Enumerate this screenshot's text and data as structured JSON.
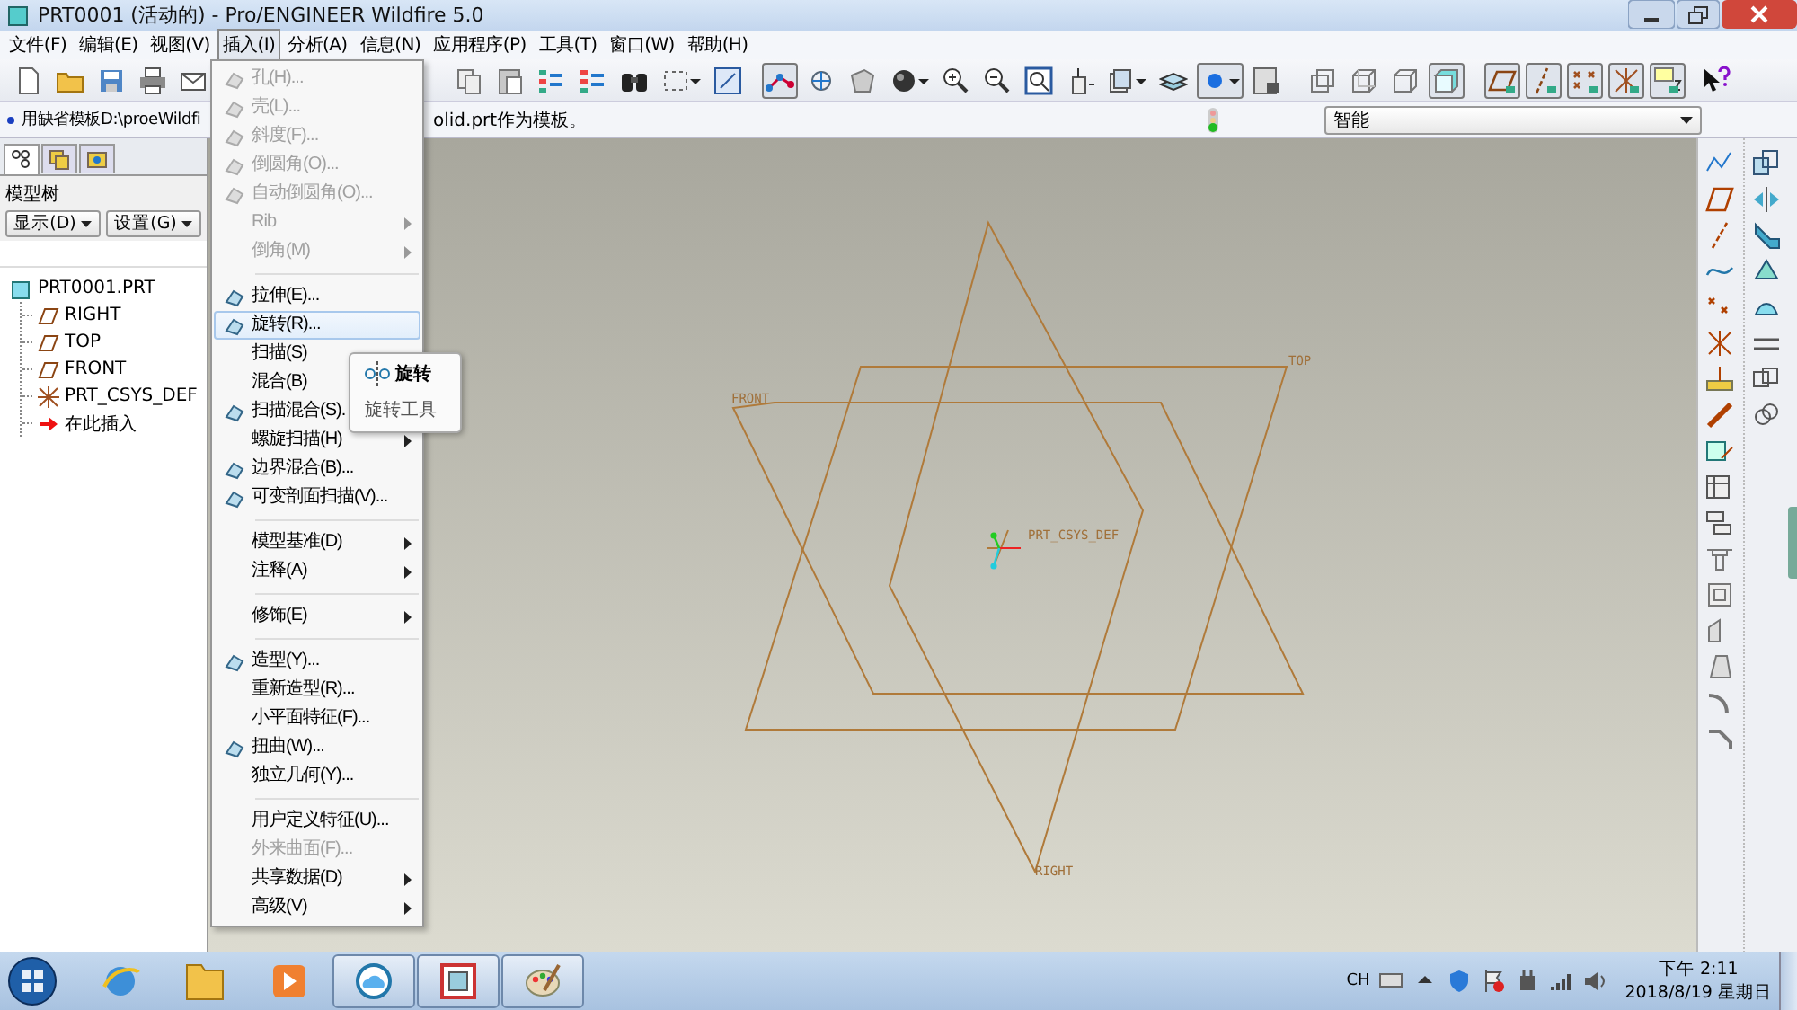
{
  "window": {
    "title": "PRT0001 (活动的) - Pro/ENGINEER Wildfire 5.0"
  },
  "menubar": [
    {
      "label": "文件(F)",
      "selected": false
    },
    {
      "label": "编辑(E)",
      "selected": false
    },
    {
      "label": "视图(V)",
      "selected": false
    },
    {
      "label": "插入(I)",
      "selected": true
    },
    {
      "label": "分析(A)",
      "selected": false
    },
    {
      "label": "信息(N)",
      "selected": false
    },
    {
      "label": "应用程序(P)",
      "selected": false
    },
    {
      "label": "工具(T)",
      "selected": false
    },
    {
      "label": "窗口(W)",
      "selected": false
    },
    {
      "label": "帮助(H)",
      "selected": false
    }
  ],
  "toolbar": {
    "buttons": [
      {
        "on": false
      },
      {
        "on": false
      },
      {
        "on": false
      },
      {
        "on": false
      },
      {
        "on": false
      },
      {
        "on": false
      },
      {
        "on": false
      },
      {
        "on": false
      },
      {
        "on": false
      },
      {
        "on": false
      },
      {
        "on": false
      },
      {
        "on": false
      },
      {
        "on": true
      },
      {
        "on": false
      },
      {
        "on": false
      },
      {
        "on": false
      },
      {
        "on": false
      },
      {
        "on": false
      },
      {
        "on": false
      },
      {
        "on": false
      },
      {
        "on": false
      },
      {
        "on": false
      },
      {
        "on": true
      },
      {
        "on": false
      },
      {
        "on": false
      },
      {
        "on": false
      },
      {
        "on": false
      },
      {
        "on": true
      },
      {
        "on": true
      },
      {
        "on": true
      },
      {
        "on": true
      },
      {
        "on": true
      },
      {
        "on": true
      },
      {
        "on": false
      }
    ]
  },
  "message_bar": {
    "segments": [
      "用缺省模板D:\\proeWildfi",
      "olid.prt作为模板。"
    ],
    "filter": {
      "value": "智能"
    }
  },
  "model_tree": {
    "tabs": [
      {
        "selected": true
      },
      {
        "selected": false
      },
      {
        "selected": false
      }
    ],
    "title": "模型树",
    "buttons": [
      "显示(D)",
      "设置(G)"
    ],
    "items": [
      {
        "label": "PRT0001.PRT",
        "kind": "part",
        "children": [
          {
            "label": "RIGHT",
            "kind": "plane"
          },
          {
            "label": "TOP",
            "kind": "plane"
          },
          {
            "label": "FRONT",
            "kind": "plane"
          },
          {
            "label": "PRT_CSYS_DEF",
            "kind": "csys"
          },
          {
            "label": "在此插入",
            "kind": "insert"
          }
        ]
      }
    ]
  },
  "viewport": {
    "datums": [
      {
        "label": "TOP",
        "kind": "plane"
      },
      {
        "label": "FRONT",
        "kind": "plane"
      },
      {
        "label": "PRT_CSYS_DEF",
        "kind": "csys"
      },
      {
        "label": "RIGHT",
        "kind": "plane"
      }
    ]
  },
  "insert_menu": {
    "groups": [
      [
        {
          "label": "孔(H)...",
          "disabled": true,
          "selected": false,
          "submenu": false,
          "has_icon": true
        },
        {
          "label": "壳(L)...",
          "disabled": true,
          "selected": false,
          "submenu": false,
          "has_icon": true
        },
        {
          "label": "斜度(F)...",
          "disabled": true,
          "selected": false,
          "submenu": false,
          "has_icon": true
        },
        {
          "label": "倒圆角(O)...",
          "disabled": true,
          "selected": false,
          "submenu": false,
          "has_icon": true
        },
        {
          "label": "自动倒圆角(O)...",
          "disabled": true,
          "selected": false,
          "submenu": false,
          "has_icon": true
        },
        {
          "label": "Rib",
          "disabled": true,
          "selected": false,
          "submenu": true,
          "has_icon": false
        },
        {
          "label": "倒角(M)",
          "disabled": true,
          "selected": false,
          "submenu": true,
          "has_icon": false
        }
      ],
      [
        {
          "label": "拉伸(E)...",
          "disabled": false,
          "selected": false,
          "submenu": false,
          "has_icon": true
        },
        {
          "label": "旋转(R)...",
          "disabled": false,
          "selected": true,
          "submenu": false,
          "has_icon": true
        },
        {
          "label": "扫描(S)",
          "disabled": false,
          "selected": false,
          "has_icon": false
        },
        {
          "label": "混合(B)",
          "disabled": false,
          "selected": false,
          "has_icon": false
        },
        {
          "label": "扫描混合(S).",
          "disabled": false,
          "selected": false,
          "submenu": false,
          "has_icon": true
        },
        {
          "label": "螺旋扫描(H)",
          "disabled": false,
          "selected": false,
          "submenu": true,
          "has_icon": false
        },
        {
          "label": "边界混合(B)...",
          "disabled": false,
          "selected": false,
          "submenu": false,
          "has_icon": true
        },
        {
          "label": "可变剖面扫描(V)...",
          "disabled": false,
          "selected": false,
          "submenu": false,
          "has_icon": true
        }
      ],
      [
        {
          "label": "模型基准(D)",
          "disabled": false,
          "selected": false,
          "submenu": true,
          "has_icon": false
        },
        {
          "label": "注释(A)",
          "disabled": false,
          "selected": false,
          "submenu": true,
          "has_icon": false
        }
      ],
      [
        {
          "label": "修饰(E)",
          "disabled": false,
          "selected": false,
          "submenu": true,
          "has_icon": false
        }
      ],
      [
        {
          "label": "造型(Y)...",
          "disabled": false,
          "selected": false,
          "submenu": false,
          "has_icon": true
        },
        {
          "label": "重新造型(R)...",
          "disabled": false,
          "selected": false,
          "submenu": false,
          "has_icon": false
        },
        {
          "label": "小平面特征(F)...",
          "disabled": false,
          "selected": false,
          "submenu": false,
          "has_icon": false
        },
        {
          "label": "扭曲(W)...",
          "disabled": false,
          "selected": false,
          "submenu": false,
          "has_icon": true
        },
        {
          "label": "独立几何(Y)...",
          "disabled": false,
          "selected": false,
          "submenu": false,
          "has_icon": false
        }
      ],
      [
        {
          "label": "用户定义特征(U)...",
          "disabled": false,
          "selected": false,
          "submenu": false,
          "has_icon": false
        },
        {
          "label": "外来曲面(F)...",
          "disabled": true,
          "selected": false,
          "submenu": false,
          "has_icon": false
        },
        {
          "label": "共享数据(D)",
          "disabled": false,
          "selected": false,
          "submenu": true,
          "has_icon": false
        },
        {
          "label": "高级(V)",
          "disabled": false,
          "selected": false,
          "submenu": true,
          "has_icon": false
        }
      ]
    ]
  },
  "tooltip": {
    "title": "旋转",
    "description": "旋转工具"
  },
  "taskbar": {
    "apps": [
      {
        "running": false
      },
      {
        "running": false
      },
      {
        "running": false
      },
      {
        "running": true
      },
      {
        "running": true
      },
      {
        "running": true
      }
    ],
    "tray": {
      "language": "CH",
      "time": "下午 2:11",
      "date": "2018/8/19 星期日"
    }
  }
}
